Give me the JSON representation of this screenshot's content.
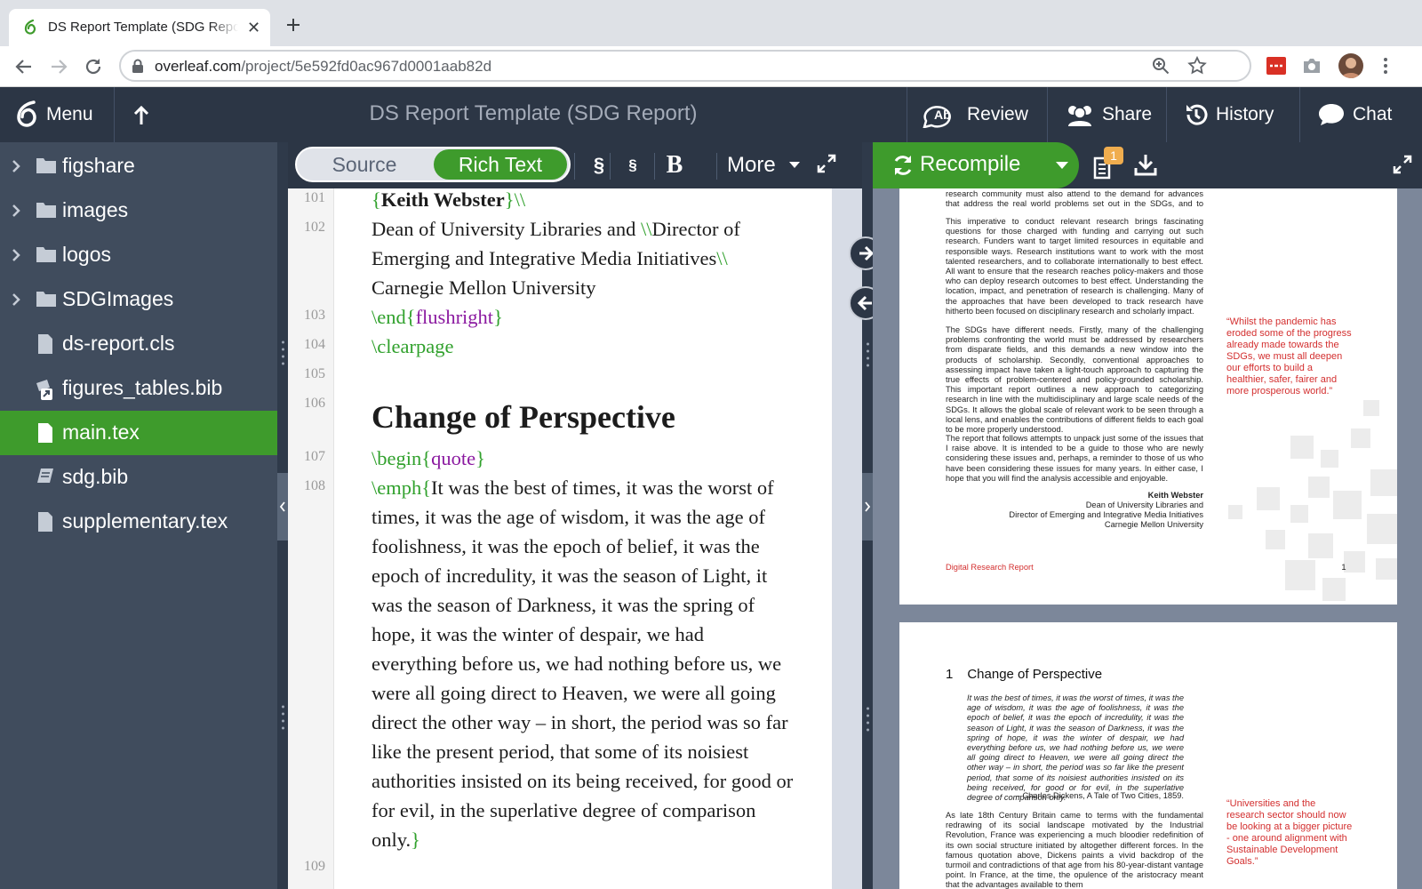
{
  "browser": {
    "tab_title": "DS Report Template (SDG Report)",
    "url_domain": "overleaf.com",
    "url_path": "/project/5e592fd0ac967d0001aab82d"
  },
  "header": {
    "menu_label": "Menu",
    "project_title": "DS Report Template (SDG Report)",
    "review_label": "Review",
    "share_label": "Share",
    "history_label": "History",
    "chat_label": "Chat"
  },
  "file_tree": {
    "items": [
      {
        "label": "figshare",
        "type": "folder"
      },
      {
        "label": "images",
        "type": "folder"
      },
      {
        "label": "logos",
        "type": "folder"
      },
      {
        "label": "SDGImages",
        "type": "folder"
      },
      {
        "label": "ds-report.cls",
        "type": "file"
      },
      {
        "label": "figures_tables.bib",
        "type": "linked-file"
      },
      {
        "label": "main.tex",
        "type": "file",
        "selected": true
      },
      {
        "label": "sdg.bib",
        "type": "bib"
      },
      {
        "label": "supplementary.tex",
        "type": "file"
      }
    ]
  },
  "editor_toolbar": {
    "source_label": "Source",
    "rich_text_label": "Rich Text",
    "section_label": "§",
    "subsection_label": "§",
    "bold_label": "B",
    "more_label": "More"
  },
  "editor": {
    "line_numbers": [
      "101",
      "102",
      "103",
      "104",
      "105",
      "106",
      "107",
      "108",
      "109"
    ],
    "l101": {
      "brace_open": "{",
      "name": "Keith Webster",
      "brace_close": "}\\\\"
    },
    "l102a": {
      "text": "Dean of University Libraries and ",
      "cmd": "\\\\",
      "text2": "Director of"
    },
    "l102b": {
      "text": "Emerging and Integrative Media Initiatives",
      "cmd": "\\\\"
    },
    "l102c": "Carnegie Mellon University",
    "l103": {
      "cmd": "\\end",
      "b1": "{",
      "arg": "flushright",
      "b2": "}"
    },
    "l104": "\\clearpage",
    "heading": "Change of Perspective",
    "l107": {
      "cmd": "\\begin",
      "b1": "{",
      "arg": "quote",
      "b2": "}"
    },
    "l108_cmd": "\\emph{",
    "l108": [
      "It was the best of times, it was the worst of",
      "times, it was the age of wisdom, it was the age of",
      "foolishness, it was the epoch of belief, it was the",
      "epoch of incredulity, it was the season of Light, it",
      "was the season of Darkness, it was the spring of",
      "hope, it was the winter of despair, we had",
      "everything before us, we had nothing before us, we",
      "were all going direct to Heaven, we were all going",
      "direct the other way – in short, the period was so far",
      "like the present period, that some of its noisiest",
      "authorities insisted on its being received, for good or",
      "for evil, in the superlative degree of comparison"
    ],
    "l108_last": "only.",
    "l108_end": "}"
  },
  "pdf_toolbar": {
    "recompile_label": "Recompile",
    "log_badge": "1"
  },
  "pdf": {
    "page1": {
      "para0": "the expansion of research and innovation in all countries. The research community must also attend to the demand for advances that address the real world problems set out in the SDGs, and to support the formulation of policy.",
      "para1": "This imperative to conduct relevant research brings fascinating questions for those charged with funding and carrying out such research. Funders want to target limited resources in equitable and responsible ways. Research institutions want to work with the most talented researchers, and to collaborate internationally to best effect. All want to ensure that the research reaches policy-makers and those who can deploy research outcomes to best effect. Understanding the location, impact, and penetration of research is challenging. Many of the approaches that have been developed to track research have hitherto been focused on disciplinary research and scholarly impact.",
      "para2": "The SDGs have different needs. Firstly, many of the challenging problems confronting the world must be addressed by researchers from disparate fields, and this demands a new window into the products of scholarship. Secondly, conventional approaches to assessing impact have taken a light-touch approach to capturing the true effects of problem-centered and policy-grounded scholarship. This important report outlines a new approach to categorizing research in line with the multidisciplinary and large scale needs of the SDGs. It allows the global scale of relevant work to be seen through a local lens, and enables the contributions of different fields to each goal to be more properly understood.",
      "para3": "The report that follows attempts to unpack just some of the issues that I raise above. It is intended to be a guide to those who are newly considering these issues and, perhaps, a reminder to those of us who have been considering these issues for many years. In either case, I hope that you will find the analysis accessible and enjoyable.",
      "sig_name": "Keith Webster",
      "sig_line1": "Dean of University Libraries and",
      "sig_line2": "Director of Emerging and Integrative Media Initiatives",
      "sig_line3": "Carnegie Mellon University",
      "pullquote": "“Whilst the pandemic has eroded some of the progress already made towards the SDGs, we must all deepen our efforts to build a healthier, safer, fairer and more prosperous world.”",
      "footer_left": "Digital Research Report",
      "page_number": "1"
    },
    "page2": {
      "section_number": "1",
      "section_title": "Change of Perspective",
      "quote": "It was the best of times, it was the worst of times, it was the age of wisdom, it was the age of foolishness, it was the epoch of belief, it was the epoch of incredulity, it was the season of Light, it was the season of Darkness, it was the spring of hope, it was the winter of despair, we had everything before us, we had nothing before us, we were all going direct to Heaven, we were all going direct the other way – in short, the period was so far like the present period, that some of its noisiest authorities insisted on its being received, for good or for evil, in the superlative degree of comparison only.",
      "attribution": "– Charles Dickens, A Tale of Two Cities, 1859.",
      "body": "As late 18th Century Britain came to terms with the fundamental redrawing of its social landscape motivated by the Industrial Revolution, France was experiencing a much bloodier redefinition of its own social structure initiated by altogether different forces. In the famous quotation above, Dickens paints a vivid backdrop of the turmoil and contradictions of that age from his 80-year-distant vantage point. In France, at the time, the opulence of the aristocracy meant that the advantages available to them",
      "pullquote": "“Universities and the research sector should now be looking at a bigger picture - one around alignment with Sustainable Development Goals.”"
    }
  },
  "colors": {
    "overleaf_green": "#3e9b2c",
    "header_bg": "#2c3645",
    "tree_bg": "#404c5d",
    "latex_command": "#31a12d",
    "latex_argument": "#8b1aa0",
    "pdf_accent": "#d32f2f"
  }
}
